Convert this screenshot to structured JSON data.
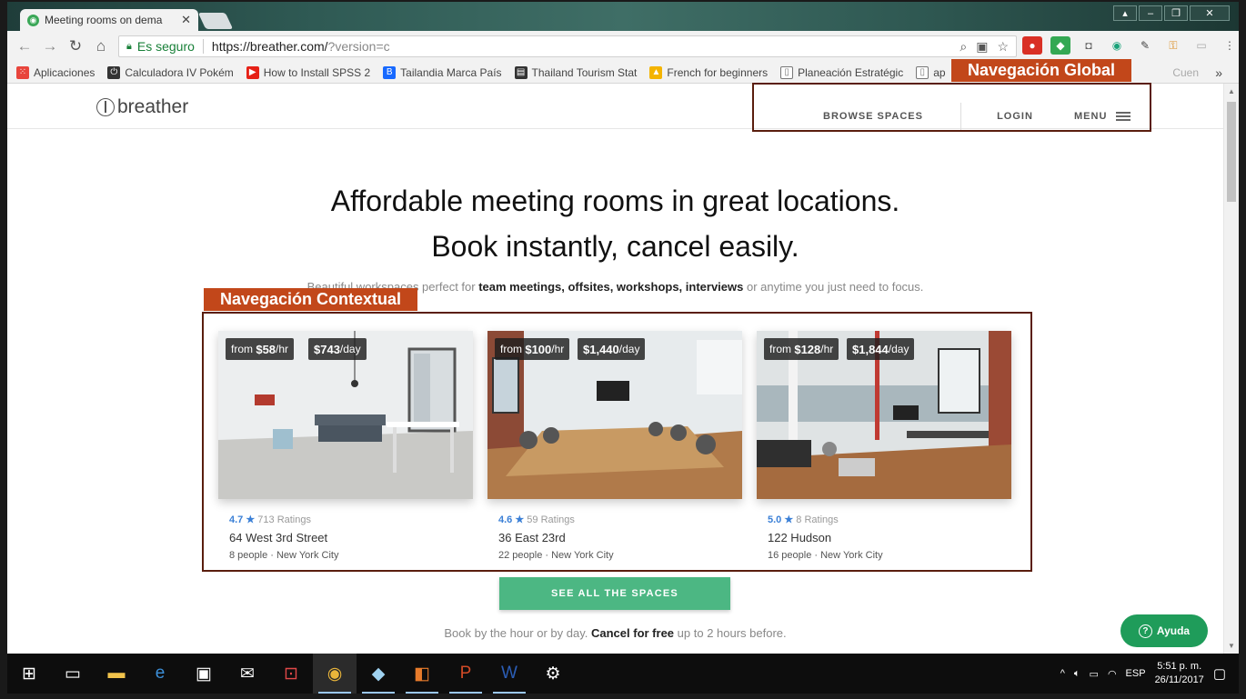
{
  "browser": {
    "tab_title": "Meeting rooms on dema",
    "tab_close": "✕",
    "secure_label": "Es seguro",
    "url_host": "https://breather.com/",
    "url_rest": "?version=c",
    "bookmarks": [
      {
        "label": "Aplicaciones",
        "color": "#e8453c"
      },
      {
        "label": "Calculadora IV Pokém",
        "color": "#333333"
      },
      {
        "label": "How to Install SPSS 2",
        "color": "#e62117"
      },
      {
        "label": "Tailandia Marca País",
        "color": "#1769ff"
      },
      {
        "label": "Thailand Tourism Stat",
        "color": "#333333"
      },
      {
        "label": "French for beginners",
        "color": "#f4b400"
      },
      {
        "label": "Planeación Estratégic",
        "color": "#777777"
      },
      {
        "label": "ap",
        "color": "#777777"
      }
    ],
    "bookmark_tail": "Cuen",
    "bookmark_more": "»"
  },
  "site": {
    "logo_text": "breather",
    "nav": {
      "browse": "BROWSE SPACES",
      "login": "LOGIN",
      "menu": "MENU"
    },
    "headline_1": "Affordable meeting rooms in great locations.",
    "headline_2": "Book instantly, cancel easily.",
    "sub_prefix": "Beautiful workspaces perfect for",
    "sub_bold": "team meetings, offsites, workshops, interviews",
    "sub_suffix": "or anytime you just need to focus.",
    "spaces": [
      {
        "hour_prefix": "from",
        "hour_price": "$58",
        "hour_unit": "/hr",
        "day_price": "$743",
        "day_unit": "/day",
        "score": "4.7 ★",
        "ratings": "713 Ratings",
        "name": "64 West 3rd Street",
        "meta": "8 people · New York City"
      },
      {
        "hour_prefix": "from",
        "hour_price": "$100",
        "hour_unit": "/hr",
        "day_price": "$1,440",
        "day_unit": "/day",
        "score": "4.6 ★",
        "ratings": "59 Ratings",
        "name": "36 East 23rd",
        "meta": "22 people · New York City"
      },
      {
        "hour_prefix": "from",
        "hour_price": "$128",
        "hour_unit": "/hr",
        "day_price": "$1,844",
        "day_unit": "/day",
        "score": "5.0 ★",
        "ratings": "8 Ratings",
        "name": "122 Hudson",
        "meta": "16 people · New York City"
      }
    ],
    "cta": "SEE ALL THE SPACES",
    "note_prefix": "Book by the hour or by day.",
    "note_bold": "Cancel for free",
    "note_suffix": "up to 2 hours before.",
    "help": "Ayuda"
  },
  "annotations": {
    "global": "Navegación Global",
    "contextual": "Navegación Contextual"
  },
  "taskbar": {
    "lang": "ESP",
    "time": "5:51 p. m.",
    "date": "26/11/2017"
  },
  "colors": {
    "accent": "#4cb783",
    "annotation": "#c2471a",
    "rating": "#3a7fd6"
  }
}
